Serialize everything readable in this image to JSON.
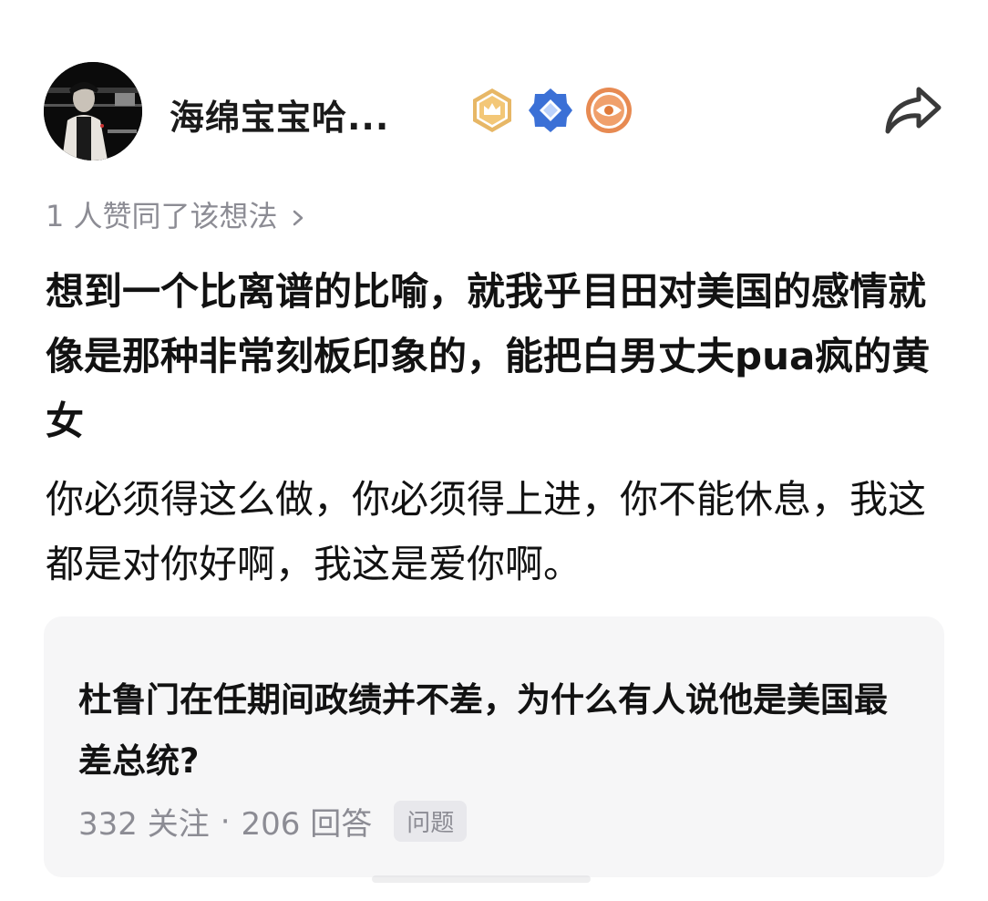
{
  "author": {
    "name": "海绵宝宝哈...",
    "avatar_icon": "avatar-photo",
    "badges": [
      {
        "icon": "crown-badge-icon",
        "color": "#e0a64a"
      },
      {
        "icon": "diamond-badge-icon",
        "color": "#3a6fd8"
      },
      {
        "icon": "eye-badge-icon",
        "color": "#e07a3a"
      }
    ]
  },
  "actions": {
    "share_icon": "share-icon"
  },
  "likes": {
    "text": "1 人赞同了该想法"
  },
  "post": {
    "title": "想到一个比离谱的比喻，就我乎目田对美国的感情就像是那种非常刻板印象的，能把白男丈夫pua疯的黄女",
    "body": "你必须得这么做，你必须得上进，你不能休息，我这都是对你好啊，我这是爱你啊。"
  },
  "question_card": {
    "title": "杜鲁门在任期间政绩并不差，为什么有人说他是美国最差总统?",
    "followers": "332 关注",
    "separator": "·",
    "answers": "206 回答",
    "tag": "问题"
  }
}
